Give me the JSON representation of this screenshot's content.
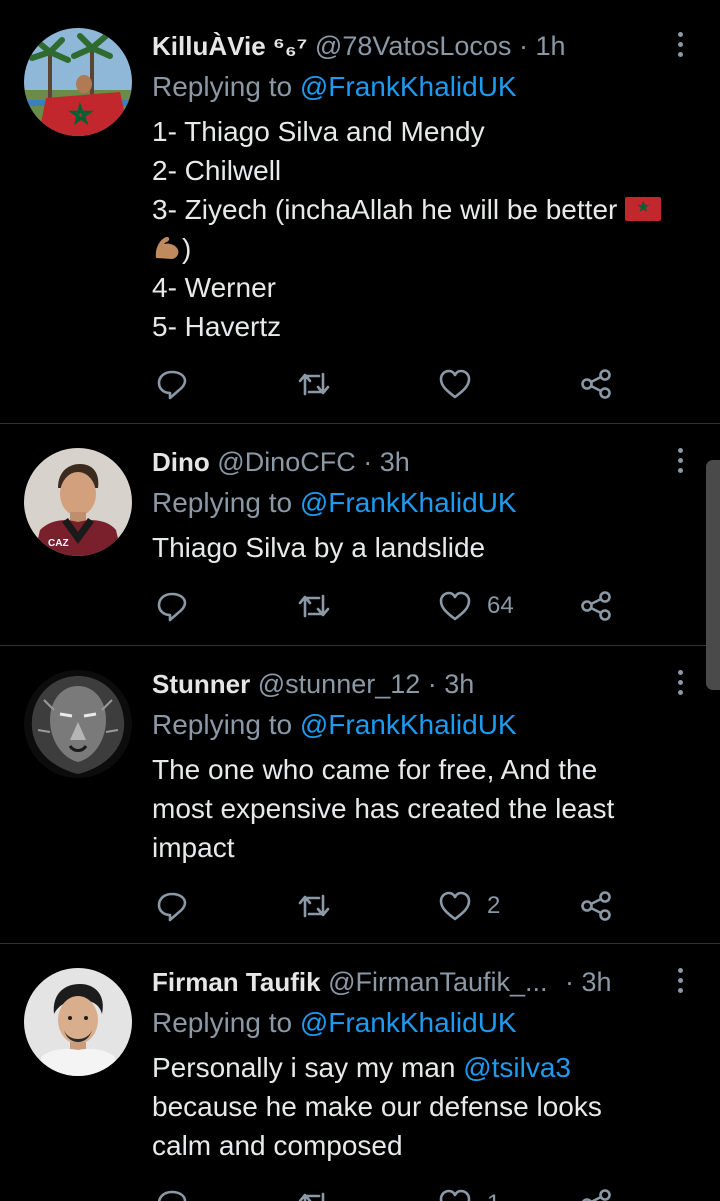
{
  "tweets": [
    {
      "name": "KilluÀVie ⁶₆⁷",
      "handle": "@78VatosLocos",
      "time": "· 1h",
      "replying_prefix": "Replying to",
      "replying_to": "@FrankKhalidUK",
      "lines": [
        "1- Thiago Silva and Mendy",
        "2- Chilwell",
        "3- Ziyech (inchaAllah he will be better",
        ")",
        "4- Werner",
        "5- Havertz"
      ],
      "likes": ""
    },
    {
      "name": "Dino",
      "handle": "@DinoCFC",
      "time": "· 3h",
      "replying_prefix": "Replying to",
      "replying_to": "@FrankKhalidUK",
      "lines": [
        "Thiago Silva by a landslide"
      ],
      "likes": "64"
    },
    {
      "name": "Stunner",
      "handle": "@stunner_12",
      "time": "· 3h",
      "replying_prefix": "Replying to",
      "replying_to": "@FrankKhalidUK",
      "lines": [
        "The one who came for free,  And the",
        "most expensive has created the least",
        "impact"
      ],
      "likes": "2"
    },
    {
      "name": "Firman Taufik",
      "handle": "@FirmanTaufik_...",
      "time": "· 3h",
      "replying_prefix": "Replying to",
      "replying_to": "@FrankKhalidUK",
      "line1_text": "Personally i say my man",
      "line1_mention": "@tsilva3",
      "lines": [
        "because he make our defense looks",
        "calm and composed"
      ],
      "likes": "1"
    }
  ],
  "icons": {
    "reply": "reply-icon",
    "retweet": "retweet-icon",
    "like": "heart-icon",
    "share": "share-icon",
    "more": "more-vertical-icon"
  },
  "colors": {
    "background": "#000000",
    "text": "#e7e9ea",
    "muted": "#8b98a5",
    "link": "#1d9bf0",
    "divider": "#2f3336"
  }
}
